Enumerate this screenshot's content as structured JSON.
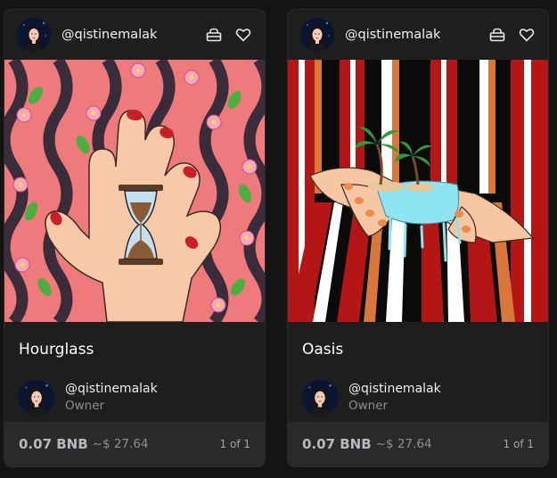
{
  "cards": [
    {
      "creator_handle": "@qistinemalak",
      "title": "Hourglass",
      "owner_name": "@qistinemalak",
      "owner_role": "Owner",
      "price": "0.07 BNB",
      "usd": "~$ 27.64",
      "edition": "1 of 1",
      "icons": [
        "unlockable-content-icon",
        "heart-icon"
      ]
    },
    {
      "creator_handle": "@qistinemalak",
      "title": "Oasis",
      "owner_name": "@qistinemalak",
      "owner_role": "Owner",
      "price": "0.07 BNB",
      "usd": "~$ 27.64",
      "edition": "1 of 1",
      "icons": [
        "unlockable-content-icon",
        "heart-icon"
      ]
    }
  ],
  "colors": {
    "page_bg": "#141414",
    "card_bg": "#1e1e1f",
    "footer_bg": "#2a2a2c",
    "hourglass_bg": "#ee7a7b",
    "oasis_stripe": "#b41515"
  }
}
